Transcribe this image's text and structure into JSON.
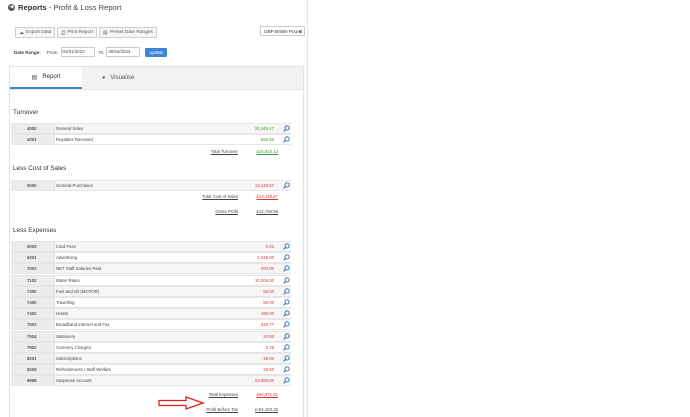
{
  "header": {
    "section": "Reports",
    "subtitle": " - Profit & Loss Report"
  },
  "toolbar": {
    "export": "Export Data",
    "print": "Print Report",
    "preset": "Preset Date Ranges"
  },
  "currency": {
    "selected": "GBP British Pound"
  },
  "date_range": {
    "label": "Date Range:",
    "from_label": "From",
    "from": "01/01/2010",
    "to_label": "To",
    "to": "30/04/2023",
    "update": "update"
  },
  "tabs": {
    "report": "Report",
    "visualise": "Visualise"
  },
  "turnover": {
    "heading": "Turnover",
    "rows": [
      {
        "code": "4000",
        "name": "General Sales",
        "amount": "25,348.47"
      },
      {
        "code": "4001",
        "name": "Royalties Received",
        "amount": "566.66"
      }
    ],
    "total_label": "Total Turnover",
    "total": "£25,915.13"
  },
  "cost_of_sales": {
    "heading": "Less Cost of Sales",
    "rows": [
      {
        "code": "5000",
        "name": "General Purchases",
        "amount": "13,148.57"
      }
    ],
    "total_label": "Total Cost of Sales",
    "total": "£13,148.57",
    "gross_label": "Gross Profit",
    "gross": "£12,766.56"
  },
  "expenses": {
    "heading": "Less Expenses",
    "rows": [
      {
        "code": "6003",
        "name": "Card Fees",
        "amount": "0.83"
      },
      {
        "code": "6201",
        "name": "Advertising",
        "amount": "2,349.00"
      },
      {
        "code": "7003",
        "name": "NET Staff Salaries Paid",
        "amount": "200.00"
      },
      {
        "code": "7102",
        "name": "Water Rates",
        "amount": "10,000.00"
      },
      {
        "code": "7300",
        "name": "Fuel and Oil (MOTOR)",
        "amount": "50.00"
      },
      {
        "code": "7400",
        "name": "Travelling",
        "amount": "50.00"
      },
      {
        "code": "7402",
        "name": "Hotels",
        "amount": "190.00"
      },
      {
        "code": "7503",
        "name": "Broadband Internet and Fax",
        "amount": "426.77"
      },
      {
        "code": "7504",
        "name": "Stationery",
        "amount": "20.00"
      },
      {
        "code": "7902",
        "name": "Currency Charges",
        "amount": "0.79"
      },
      {
        "code": "8201",
        "name": "Subscriptions",
        "amount": "19.00"
      },
      {
        "code": "8205",
        "name": "Refreshments / Staff Welfare",
        "amount": "25.50"
      },
      {
        "code": "9998",
        "name": "Suspense Account",
        "amount": "53,550.00"
      }
    ],
    "total_label": "Total Expenses",
    "total": "£66,871.81",
    "net_label": "Profit Before Tax",
    "net": "£-54,103.25"
  },
  "colors": {
    "accent": "#3a87d8",
    "positive": "#3b9a3b",
    "negative": "#dd3333",
    "arrow": "#e02020"
  },
  "icons": {
    "row_action": "search-icon",
    "back": "circle-arrow-left-icon"
  }
}
